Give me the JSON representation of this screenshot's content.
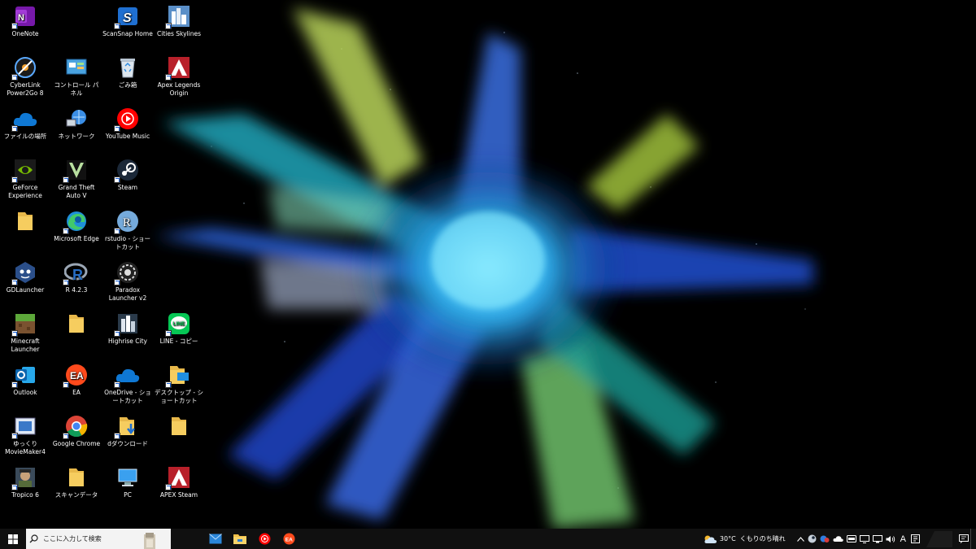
{
  "desktop": {
    "icons": [
      {
        "label": "OneNote",
        "icon": "onenote-icon"
      },
      {
        "label": "ScanSnap Home",
        "icon": "scansnap-icon"
      },
      {
        "label": "Cities Skylines",
        "icon": "cities-skylines-icon"
      },
      {
        "label": "CyberLink Power2Go 8",
        "icon": "power2go-icon"
      },
      {
        "label": "コントロール パネル",
        "icon": "control-panel-icon"
      },
      {
        "label": "ごみ箱",
        "icon": "recycle-bin-icon"
      },
      {
        "label": "Apex Legends Origin",
        "icon": "apex-icon"
      },
      {
        "label": "ファイルの場所",
        "icon": "onedrive-icon"
      },
      {
        "label": "ネットワーク",
        "icon": "network-icon"
      },
      {
        "label": "YouTube Music",
        "icon": "youtube-music-icon"
      },
      {
        "label": "GeForce Experience",
        "icon": "geforce-icon"
      },
      {
        "label": "Grand Theft Auto V",
        "icon": "gta-icon"
      },
      {
        "label": "Steam",
        "icon": "steam-icon"
      },
      {
        "label": "",
        "icon": "folder-icon"
      },
      {
        "label": "Microsoft Edge",
        "icon": "edge-icon"
      },
      {
        "label": "rstudio - ショートカット",
        "icon": "rstudio-icon"
      },
      {
        "label": "GDLauncher",
        "icon": "gdlauncher-icon"
      },
      {
        "label": "R 4.2.3",
        "icon": "r-icon"
      },
      {
        "label": "Paradox Launcher v2",
        "icon": "paradox-icon"
      },
      {
        "label": "Minecraft Launcher",
        "icon": "minecraft-icon"
      },
      {
        "label": "",
        "icon": "folder-icon"
      },
      {
        "label": "Highrise City",
        "icon": "highrise-icon"
      },
      {
        "label": "LINE - コピー",
        "icon": "line-icon"
      },
      {
        "label": "Outlook",
        "icon": "outlook-icon"
      },
      {
        "label": "EA",
        "icon": "ea-icon"
      },
      {
        "label": "OneDrive - ショートカット",
        "icon": "onedrive-icon"
      },
      {
        "label": "デスクトップ - ショートカット",
        "icon": "desktop-folder-icon"
      },
      {
        "label": "ゆっくり MovieMaker4",
        "icon": "ymm-icon"
      },
      {
        "label": "Google Chrome",
        "icon": "chrome-icon"
      },
      {
        "label": "dダウンロード",
        "icon": "download-folder-icon"
      },
      {
        "label": "",
        "icon": "folder-icon"
      },
      {
        "label": "Tropico 6",
        "icon": "tropico-icon"
      },
      {
        "label": "スキャンデータ",
        "icon": "folder-icon"
      },
      {
        "label": "PC",
        "icon": "pc-icon"
      },
      {
        "label": "APEX Steam",
        "icon": "apex-icon"
      }
    ]
  },
  "taskbar": {
    "search_placeholder": "ここに入力して検索",
    "pinned_apps": [
      "mail-icon",
      "file-explorer-icon",
      "youtube-music-icon",
      "ea-icon"
    ],
    "weather_temp": "30°C",
    "weather_text": "くもりのち晴れ",
    "ime_mode": "A"
  },
  "colors": {
    "taskbar": "#101010",
    "search_bg": "#f3f3f3",
    "accent_blue": "#1a5fd0"
  }
}
